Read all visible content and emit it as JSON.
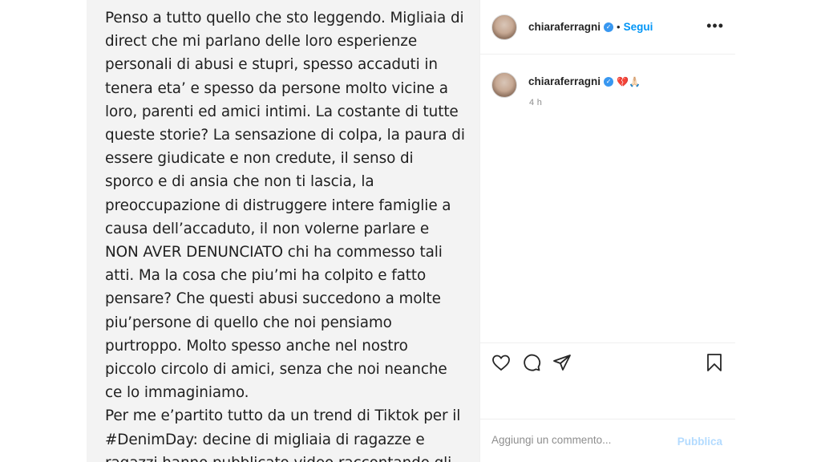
{
  "post": {
    "text_lines": [
      "Penso a tutto quello che sto leggendo. Migliaia di",
      "direct che mi parlano delle loro esperienze",
      "personali di abusi e stupri, spesso accaduti in",
      "tenera eta’ e spesso da persone molto vicine a",
      "loro, parenti ed amici intimi. La costante di tutte",
      "queste storie? La sensazione di colpa, la paura di",
      "essere giudicate e non credute, il senso di",
      "sporco e di ansia che non ti lascia, la",
      "preoccupazione di distruggere intere famiglie a",
      "causa dell’accaduto, il non volerne parlare e",
      "NON AVER DENUNCIATO chi ha commesso tali",
      "atti. Ma la cosa che piu’mi ha colpito e fatto",
      "pensare? Che questi abusi succedono a molte",
      "piu’persone di quello che noi pensiamo",
      "purtroppo. Molto spesso anche nel nostro",
      "piccolo circolo di amici, senza che noi neanche",
      "ce lo immaginiamo.",
      "Per me e’partito tutto da un trend di Tiktok per il",
      "#DenimDay: decine di migliaia di ragazze e",
      "ragazzi hanno pubblicato video raccontando gli"
    ],
    "next_icon": "chevron-right-icon"
  },
  "header": {
    "username": "chiaraferragni",
    "separator": "•",
    "follow_label": "Segui",
    "more_label": "•••"
  },
  "caption": {
    "username": "chiaraferragni",
    "emoji": "💔🙏🏻",
    "time": "4 h"
  },
  "actions": {
    "icons": [
      "heart-icon",
      "comment-icon",
      "share-icon",
      "bookmark-icon"
    ]
  },
  "comment": {
    "placeholder": "Aggiungi un commento...",
    "publish_label": "Pubblica"
  },
  "colors": {
    "accent": "#0095f6",
    "verified": "#3897f0",
    "publish_disabled": "#b3dbff",
    "post_background": "#f3f3f3"
  }
}
